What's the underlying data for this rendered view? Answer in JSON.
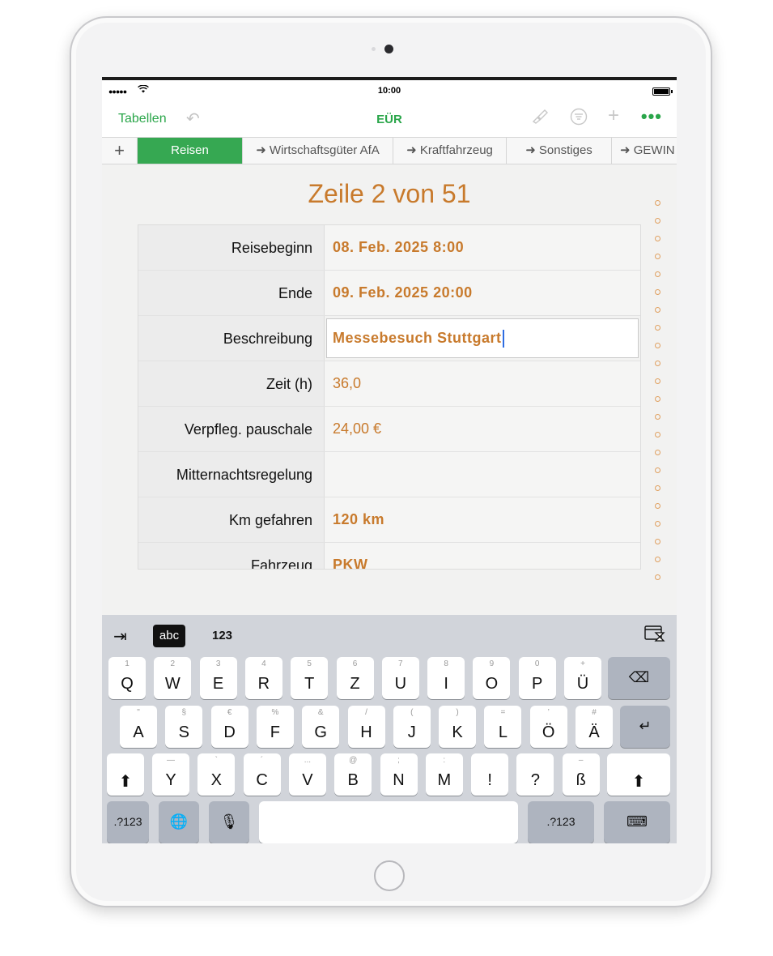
{
  "status": {
    "time": "10:00",
    "signal": "●●●●●",
    "wifi": "wifi-icon"
  },
  "nav": {
    "back_label": "Tabellen",
    "title": "EÜR"
  },
  "tabs": {
    "add": "+",
    "items": [
      "Reisen",
      "➜ Wirtschaftsgüter AfA",
      "➜ Kraftfahrzeug",
      "➜ Sonstiges",
      "➜ GEWIN"
    ]
  },
  "record": {
    "title": "Zeile 2 von 51",
    "fields": [
      {
        "label": "Reisebeginn",
        "value": "08. Feb. 2025  8:00"
      },
      {
        "label": "Ende",
        "value": "09. Feb. 2025  20:00"
      },
      {
        "label": "Beschreibung",
        "value": "Messebesuch Stuttgart"
      },
      {
        "label": "Zeit (h)",
        "value": "36,0"
      },
      {
        "label": "Verpfleg. pauschale",
        "value": "24,00 €"
      },
      {
        "label": "Mitternachtsregelung",
        "value": ""
      },
      {
        "label": "Km gefahren",
        "value": "120 km"
      },
      {
        "label": "Fahrzeug",
        "value": "PKW"
      }
    ]
  },
  "keyboard": {
    "toolbar": {
      "abc": "abc",
      "num": "123"
    },
    "row1": [
      {
        "sub": "1",
        "main": "Q"
      },
      {
        "sub": "2",
        "main": "W"
      },
      {
        "sub": "3",
        "main": "E"
      },
      {
        "sub": "4",
        "main": "R"
      },
      {
        "sub": "5",
        "main": "T"
      },
      {
        "sub": "6",
        "main": "Z"
      },
      {
        "sub": "7",
        "main": "U"
      },
      {
        "sub": "8",
        "main": "I"
      },
      {
        "sub": "9",
        "main": "O"
      },
      {
        "sub": "0",
        "main": "P"
      },
      {
        "sub": "+",
        "main": "Ü"
      }
    ],
    "row2": [
      {
        "sub": "\"",
        "main": "A"
      },
      {
        "sub": "§",
        "main": "S"
      },
      {
        "sub": "€",
        "main": "D"
      },
      {
        "sub": "%",
        "main": "F"
      },
      {
        "sub": "&",
        "main": "G"
      },
      {
        "sub": "/",
        "main": "H"
      },
      {
        "sub": "(",
        "main": "J"
      },
      {
        "sub": ")",
        "main": "K"
      },
      {
        "sub": "=",
        "main": "L"
      },
      {
        "sub": "’",
        "main": "Ö"
      },
      {
        "sub": "#",
        "main": "Ä"
      }
    ],
    "row3": [
      {
        "sub": "—",
        "main": "Y"
      },
      {
        "sub": "`",
        "main": "X"
      },
      {
        "sub": "´",
        "main": "C"
      },
      {
        "sub": "...",
        "main": "V"
      },
      {
        "sub": "@",
        "main": "B"
      },
      {
        "sub": ";",
        "main": "N"
      },
      {
        "sub": ":",
        "main": "M"
      },
      {
        "sub": "",
        "main": "!"
      },
      {
        "sub": "",
        "main": "?"
      },
      {
        "sub": "–",
        "main": "ß"
      }
    ],
    "row4": {
      "num_left": ".?123",
      "num_right": ".?123"
    }
  }
}
